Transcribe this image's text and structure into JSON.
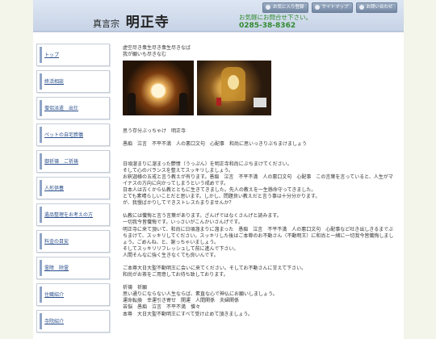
{
  "header": {
    "sect": "真言宗",
    "temple": "明正寺",
    "contact_note": "お気軽にお問合せ下さい。",
    "tel": "0285-38-8362",
    "buttons": [
      "お気に入り登録",
      "サイトマップ",
      "お問い合わせ"
    ]
  },
  "sidebar": {
    "items": [
      {
        "label": "トップ"
      },
      {
        "label": "終活相談"
      },
      {
        "label": "僧侶派遣　出仕"
      },
      {
        "label": "ペットの自宅葬儀"
      },
      {
        "label": "御祈禱　ご祈祷"
      },
      {
        "label": "人形供養"
      },
      {
        "label": "遺品整理をお考えの方"
      },
      {
        "label": "料金の目安"
      },
      {
        "label": "霊障　除霊"
      },
      {
        "label": "住職紹介"
      },
      {
        "label": "寺院紹介"
      }
    ]
  },
  "main": {
    "intro_line1": "虚空尽き衆生尽き衆生尽きなば",
    "intro_line2": "我が願いも尽きなむ",
    "para1_line1": "思う存分ぶっちゃけ　明正寺",
    "para1_line2": "愚痴　泣言　不平不満　人の悪口文句　心配事　和尚に思いっきりぶちまけましょう",
    "para2": "日頃溜まりに溜まった鬱憤（うっぷん）を明正寺和尚にぶちまけてください。\nそして心のバランスを整えてスッキリしましょう。\nお釈迦様の五戒と言う教えが有ります。愚痴　泣言　不平不満　人の悪口文句　心配事　この言葉を言っていると、人生がマイナスの方向に向かってしまうという戒めです。\n日本人は古くから仏教とともに生きてきました。先人の教えを一生懸命守ってきました。\nとても素晴らしいことだと思います。しかし、問題良い教えだと言う事は十分分かります。\nが、我慢ばかりしてできストレスたまりませんか？",
    "para3": "仏教には懺悔と言う言葉があります。ざんげではなくさんげと読みます。\n一切我今皆懺悔です。いっさいがこんかいさんげです。\n明正寺に来て頂いて、和尚に日頃溜まりに溜まった　愚痴　泣言　不平不満　人の悪口文句　心配事など吐き出しきるまでぶちまけて、スッキリしてください。スッキリした後はご本尊のお不動さん（不動明王）に和尚と一緒に一切我今皆懺悔しましょう。ごめんね、と、謝っちゃいましょう。\nそしてスッキリリフレッシュして前に進んで下さい。\n人間そんなに強く生きなくても良いんです。",
    "para4": "ご本尊大日大聖不動明王に会いに来てください。そしてお不動さんに甘えて下さい。\n和尚がお茶をご用意してお待ち致しております。",
    "para5": "祈禱　祈願\n思い通りにならない人生ならば、素直な心で神仏にお願いしましょう。\n運命転換　幸運引き寄せ　開運　人間関係　夫婦関係\n苦悩　愚痴　泣言　不平不満　憎々\n本尊　大日大聖不動明王にすべて受け止めて頂きましょう。"
  }
}
